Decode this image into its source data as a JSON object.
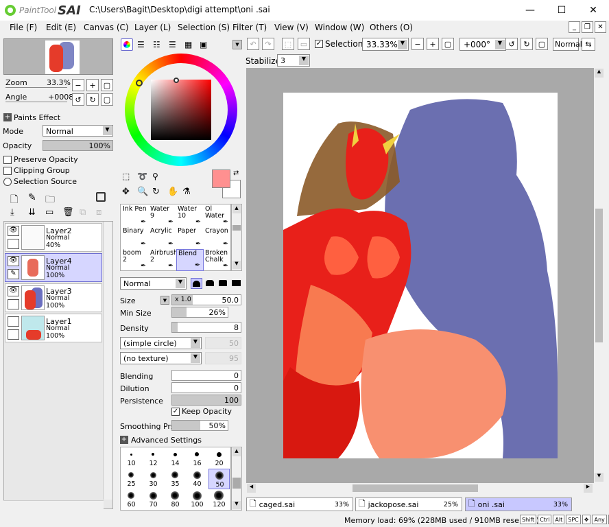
{
  "window": {
    "app_name_small": "PaintTool",
    "app_name_big": "SAI",
    "title": "C:\\Users\\Bagit\\Desktop\\digi attempt\\oni .sai",
    "minimize": "—",
    "maximize": "☐",
    "close": "✕"
  },
  "menu": [
    "File (F)",
    "Edit (E)",
    "Canvas (C)",
    "Layer (L)",
    "Selection (S)",
    "Filter (T)",
    "View (V)",
    "Window (W)",
    "Others (O)"
  ],
  "navigator": {
    "zoom_label": "Zoom",
    "zoom_value": "33.3%",
    "angle_label": "Angle",
    "angle_value": "+0008"
  },
  "layer_props": {
    "paints_effect": "Paints Effect",
    "mode_label": "Mode",
    "mode_value": "Normal",
    "opacity_label": "Opacity",
    "opacity_value": "100%",
    "preserve_opacity": "Preserve Opacity",
    "clipping_group": "Clipping Group",
    "selection_source": "Selection Source"
  },
  "layers": [
    {
      "name": "Layer2",
      "mode": "Normal",
      "opacity": "40%"
    },
    {
      "name": "Layer4",
      "mode": "Normal",
      "opacity": "100%"
    },
    {
      "name": "Layer3",
      "mode": "Normal",
      "opacity": "100%"
    },
    {
      "name": "Layer1",
      "mode": "Normal",
      "opacity": "100%"
    }
  ],
  "colors": {
    "primary": "#ff9090",
    "accent": "#6b6bd0"
  },
  "tools": [
    {
      "name": "Ink Pen",
      "num": ""
    },
    {
      "name": "Water",
      "num": "9"
    },
    {
      "name": "Water",
      "num": "10"
    },
    {
      "name": "Ol Water",
      "num": ""
    },
    {
      "name": "Binary",
      "num": ""
    },
    {
      "name": "Acrylic",
      "num": ""
    },
    {
      "name": "Paper",
      "num": ""
    },
    {
      "name": "Crayon",
      "num": ""
    },
    {
      "name": "boom",
      "num": "2"
    },
    {
      "name": "Airbrush",
      "num": "2"
    },
    {
      "name": "Blend",
      "num": ""
    },
    {
      "name": "Broken Chalk",
      "num": ""
    }
  ],
  "brush": {
    "mode": "Normal",
    "size_label": "Size",
    "size_mult": "x 1.0",
    "size_value": "50.0",
    "minsize_label": "Min Size",
    "minsize_value": "26%",
    "density_label": "Density",
    "density_value": "8",
    "shape": "(simple circle)",
    "shape_val": "50",
    "texture": "(no texture)",
    "texture_val": "95",
    "blending_label": "Blending",
    "blending_value": "0",
    "dilution_label": "Dilution",
    "dilution_value": "0",
    "persistence_label": "Persistence",
    "persistence_value": "100",
    "keep_opacity": "Keep Opacity",
    "smoothing_label": "Smoothing Prs",
    "smoothing_value": "50%",
    "advanced": "Advanced Settings"
  },
  "brush_sizes": [
    "10",
    "12",
    "14",
    "16",
    "20",
    "25",
    "30",
    "35",
    "40",
    "50",
    "60",
    "70",
    "80",
    "100",
    "120"
  ],
  "canvas_toolbar": {
    "selection": "Selection",
    "zoom": "33.33%",
    "angle": "+000°",
    "blend_mode": "Normal",
    "stabilizer_label": "Stabilizer",
    "stabilizer_value": "3"
  },
  "tabs": [
    {
      "name": "caged.sai",
      "zoom": "33%"
    },
    {
      "name": "jackopose.sai",
      "zoom": "25%"
    },
    {
      "name": "oni .sai",
      "zoom": "33%"
    }
  ],
  "status": {
    "memory": "Memory load: 69% (228MB used / 910MB reserved)",
    "keys": [
      "Shift",
      "Ctrl",
      "Alt",
      "SPC",
      "✥",
      "Any",
      "✎"
    ]
  }
}
